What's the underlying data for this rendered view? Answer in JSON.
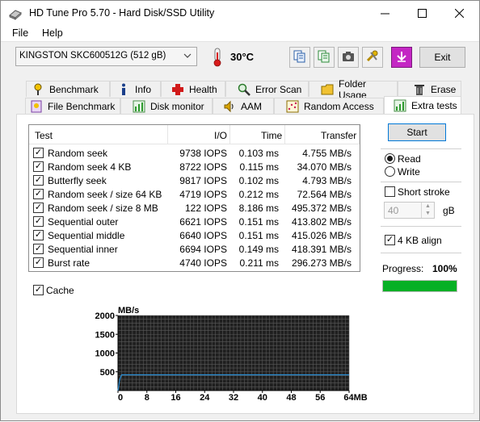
{
  "window": {
    "title": "HD Tune Pro 5.70 - Hard Disk/SSD Utility"
  },
  "menu": {
    "file": "File",
    "help": "Help"
  },
  "toolbar": {
    "drive": "KINGSTON SKC600512G (512 gB)",
    "temperature": "30°C",
    "exit_label": "Exit",
    "icons": [
      "copy-info-icon",
      "copy-text-icon",
      "screenshot-camera-icon",
      "options-tools-icon",
      "save-download-icon"
    ]
  },
  "tabs_row1": [
    {
      "label": "Benchmark",
      "icon": "benchmark-icon"
    },
    {
      "label": "Info",
      "icon": "info-icon"
    },
    {
      "label": "Health",
      "icon": "health-cross-icon"
    },
    {
      "label": "Error Scan",
      "icon": "magnifier-icon"
    },
    {
      "label": "Folder Usage",
      "icon": "folder-icon"
    },
    {
      "label": "Erase",
      "icon": "trash-icon"
    }
  ],
  "tabs_row2": [
    {
      "label": "File Benchmark",
      "icon": "file-benchmark-icon"
    },
    {
      "label": "Disk monitor",
      "icon": "disk-monitor-icon"
    },
    {
      "label": "AAM",
      "icon": "speaker-icon"
    },
    {
      "label": "Random Access",
      "icon": "random-access-icon"
    },
    {
      "label": "Extra tests",
      "icon": "extra-tests-icon"
    }
  ],
  "table": {
    "headers": {
      "test": "Test",
      "io": "I/O",
      "time": "Time",
      "transfer": "Transfer"
    },
    "rows": [
      {
        "checked": true,
        "test": "Random seek",
        "io": "9738 IOPS",
        "time": "0.103 ms",
        "transfer": "4.755 MB/s"
      },
      {
        "checked": true,
        "test": "Random seek 4 KB",
        "io": "8722 IOPS",
        "time": "0.115 ms",
        "transfer": "34.070 MB/s"
      },
      {
        "checked": true,
        "test": "Butterfly seek",
        "io": "9817 IOPS",
        "time": "0.102 ms",
        "transfer": "4.793 MB/s"
      },
      {
        "checked": true,
        "test": "Random seek / size 64 KB",
        "io": "4719 IOPS",
        "time": "0.212 ms",
        "transfer": "72.564 MB/s"
      },
      {
        "checked": true,
        "test": "Random seek / size 8 MB",
        "io": "122 IOPS",
        "time": "8.186 ms",
        "transfer": "495.372 MB/s"
      },
      {
        "checked": true,
        "test": "Sequential outer",
        "io": "6621 IOPS",
        "time": "0.151 ms",
        "transfer": "413.802 MB/s"
      },
      {
        "checked": true,
        "test": "Sequential middle",
        "io": "6640 IOPS",
        "time": "0.151 ms",
        "transfer": "415.026 MB/s"
      },
      {
        "checked": true,
        "test": "Sequential inner",
        "io": "6694 IOPS",
        "time": "0.149 ms",
        "transfer": "418.391 MB/s"
      },
      {
        "checked": true,
        "test": "Burst rate",
        "io": "4740 IOPS",
        "time": "0.211 ms",
        "transfer": "296.273 MB/s"
      }
    ]
  },
  "cache": {
    "label": "Cache",
    "checked": true
  },
  "controls": {
    "start_label": "Start",
    "read_label": "Read",
    "write_label": "Write",
    "mode": "read",
    "short_stroke_label": "Short stroke",
    "short_stroke_checked": false,
    "short_stroke_value": "40",
    "short_stroke_unit": "gB",
    "align_label": "4 KB align",
    "align_checked": true,
    "progress_label": "Progress:",
    "progress_value": "100%",
    "progress_fraction": 1.0
  },
  "chart_data": {
    "type": "line",
    "ylabel": "MB/s",
    "xlabel": "",
    "x_tick_labels": [
      "0",
      "8",
      "16",
      "24",
      "32",
      "40",
      "48",
      "56",
      "64MB"
    ],
    "y_tick_labels": [
      "500",
      "1000",
      "1500",
      "2000"
    ],
    "ylim": [
      0,
      2000
    ],
    "xlim": [
      0,
      64
    ],
    "series": [
      {
        "x": [
          0,
          0.5,
          1,
          64
        ],
        "y": [
          0,
          300,
          420,
          420
        ]
      }
    ],
    "colors": {
      "background": "#1f1f1f",
      "grid": "#5a5a5a",
      "line": "#2a8fd6"
    }
  }
}
